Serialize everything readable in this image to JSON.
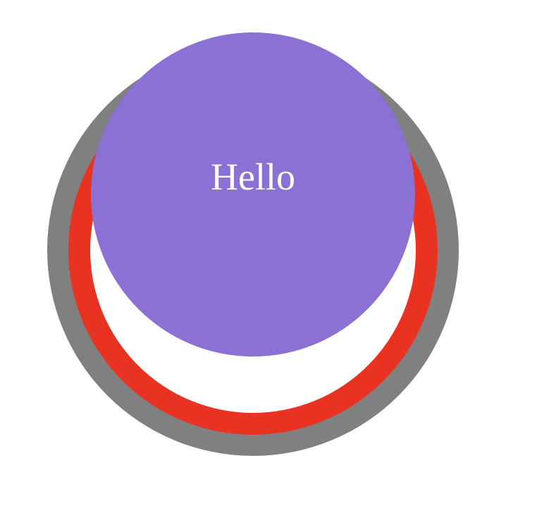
{
  "button": {
    "label": "Hello"
  },
  "colors": {
    "outer_ring": "#808080",
    "red_ring": "#e93322",
    "inner_background": "#ffffff",
    "button_fill": "#8b71d4",
    "button_text": "#ffffff"
  }
}
